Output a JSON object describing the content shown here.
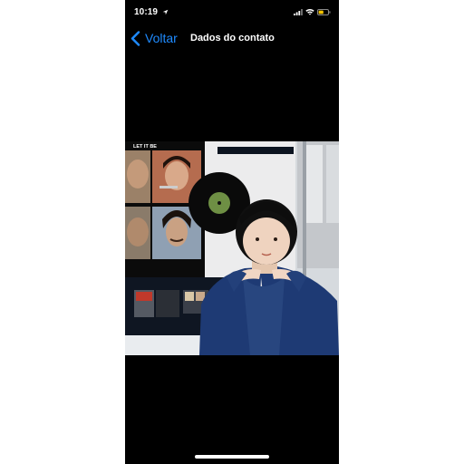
{
  "status_bar": {
    "time": "10:19",
    "icons": [
      "location-icon",
      "signal-icon",
      "wifi-icon",
      "battery-icon"
    ],
    "battery_color": "#f4c400"
  },
  "nav": {
    "back_label": "Voltar",
    "title": "Dados do contato",
    "accent_color": "#1f8bff"
  },
  "photo": {
    "poster_title": "LET IT BE"
  }
}
